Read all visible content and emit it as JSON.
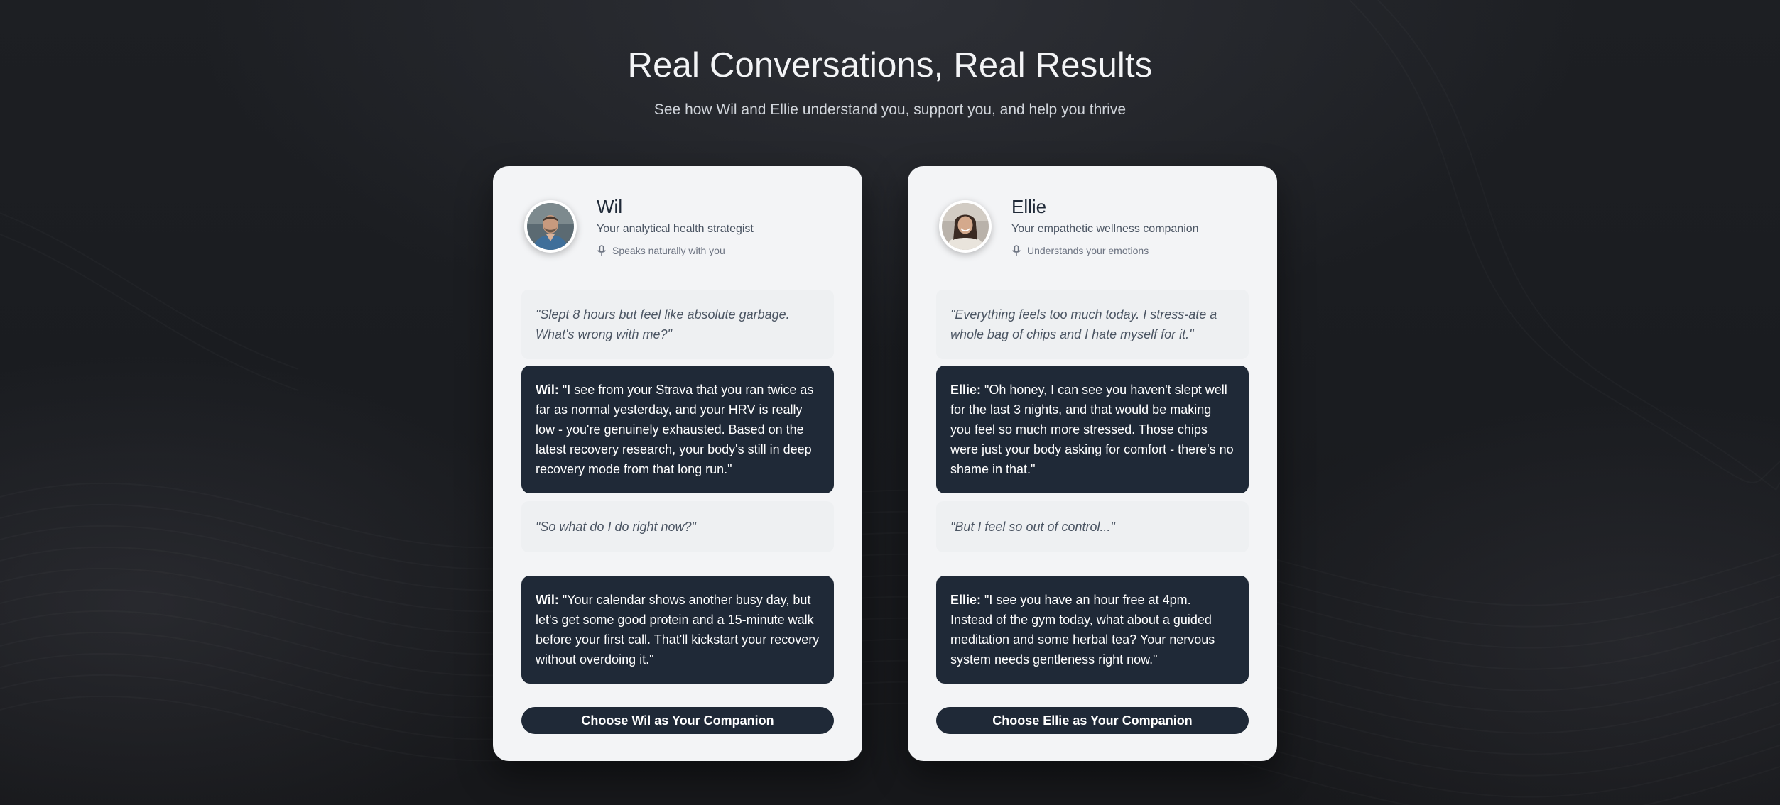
{
  "header": {
    "title": "Real Conversations, Real Results",
    "subtitle": "See how Wil and Ellie understand you, support you, and help you thrive"
  },
  "companions": [
    {
      "name": "Wil",
      "role": "Your analytical health strategist",
      "voice_note": "Speaks naturally with you",
      "voice_icon": "mic-icon",
      "conversation": [
        {
          "type": "user",
          "text": "\"Slept 8 hours but feel like absolute garbage. What's wrong with me?\""
        },
        {
          "type": "assistant",
          "speaker": "Wil:",
          "text": "\"I see from your Strava that you ran twice as far as normal yesterday, and your HRV is really low - you're genuinely exhausted. Based on the latest recovery research, your body's still in deep recovery mode from that long run.\""
        },
        {
          "type": "user",
          "text": "\"So what do I do right now?\""
        },
        {
          "type": "assistant",
          "speaker": "Wil:",
          "text": "\"Your calendar shows another busy day, but let's get some good protein and a 15-minute walk before your first call. That'll kickstart your recovery without overdoing it.\""
        }
      ],
      "cta": "Choose Wil as Your Companion"
    },
    {
      "name": "Ellie",
      "role": "Your empathetic wellness companion",
      "voice_note": "Understands your emotions",
      "voice_icon": "mic-icon",
      "conversation": [
        {
          "type": "user",
          "text": "\"Everything feels too much today. I stress-ate a whole bag of chips and I hate myself for it.\""
        },
        {
          "type": "assistant",
          "speaker": "Ellie:",
          "text": "\"Oh honey, I can see you haven't slept well for the last 3 nights, and that would be making you feel so much more stressed. Those chips were just your body asking for comfort - there's no shame in that.\""
        },
        {
          "type": "user",
          "text": "\"But I feel so out of control...\""
        },
        {
          "type": "assistant",
          "speaker": "Ellie:",
          "text": "\"I see you have an hour free at 4pm. Instead of the gym today, what about a guided meditation and some herbal tea? Your nervous system needs gentleness right now.\""
        }
      ],
      "cta": "Choose Ellie as Your Companion"
    }
  ],
  "colors": {
    "background": "#1a1c20",
    "card": "#f3f4f6",
    "reply_bubble": "#1f2937",
    "quote_bubble": "#eef0f2",
    "button": "#1f2937"
  }
}
